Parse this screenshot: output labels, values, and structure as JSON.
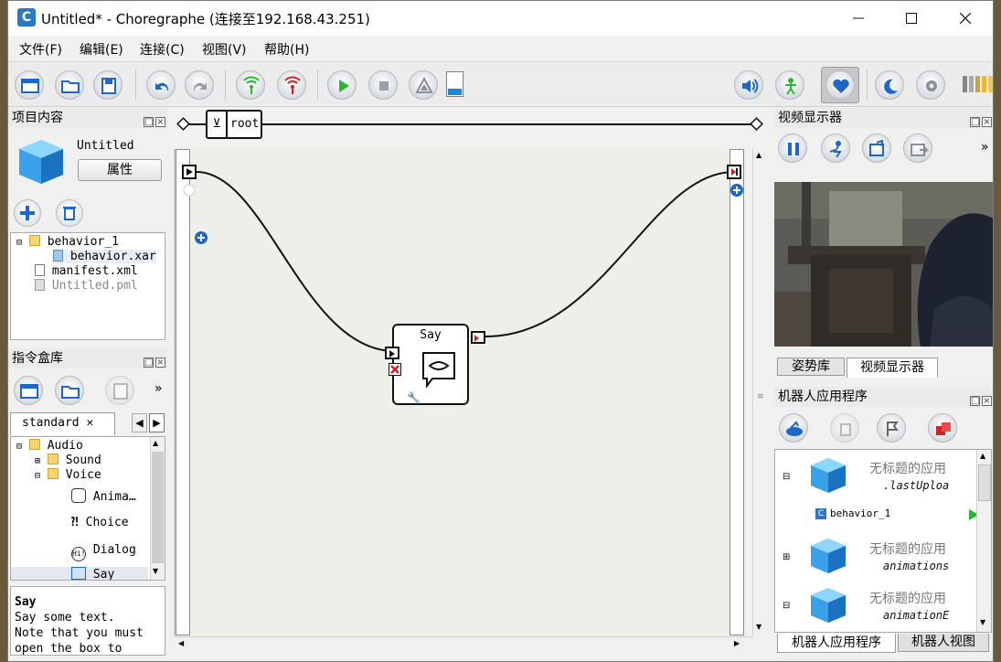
{
  "window": {
    "title": "Untitled* - Choregraphe (连接至192.168.43.251)",
    "app_icon": "C",
    "controls": [
      "minimize",
      "maximize",
      "close"
    ]
  },
  "menu": [
    "文件(F)",
    "编辑(E)",
    "连接(C)",
    "视图(V)",
    "帮助(H)"
  ],
  "toolbar": {
    "icons": [
      "new-window-icon",
      "open-folder-icon",
      "save-icon",
      "undo-icon",
      "redo-icon",
      "connect-icon",
      "disconnect-icon",
      "play-icon",
      "stop-icon",
      "debug-icon",
      "volume-icon",
      "robot-posture-icon",
      "heart-icon",
      "sleep-icon",
      "settings-icon",
      "battery-icon"
    ],
    "accent_green": "#2db52d",
    "accent_blue": "#1e66c8",
    "accent_red": "#d02020"
  },
  "project": {
    "header": "项目内容",
    "name": "Untitled",
    "properties_button": "属性",
    "tree": [
      {
        "label": "behavior_1",
        "type": "folder"
      },
      {
        "label": "behavior.xar",
        "type": "file"
      },
      {
        "label": "manifest.xml",
        "type": "file"
      },
      {
        "label": "Untitled.pml",
        "type": "file-grey"
      }
    ]
  },
  "library": {
    "header": "指令盒库",
    "tab": "standard",
    "tree": [
      {
        "label": "Audio"
      },
      {
        "label": "Sound"
      },
      {
        "label": "Voice"
      },
      {
        "label": "Anima…"
      },
      {
        "label": "Choice"
      },
      {
        "label": "Dialog"
      },
      {
        "label": "Say"
      }
    ],
    "description": {
      "title": "Say",
      "line1": "Say some text.",
      "line2": "Note that you must",
      "line3": "open the box to"
    }
  },
  "flow": {
    "breadcrumb": "root",
    "box_title": "Say"
  },
  "video_panel": {
    "header": "视频显示器",
    "tabs": [
      "姿势库",
      "视频显示器"
    ]
  },
  "robot_apps": {
    "header": "机器人应用程序",
    "items": [
      {
        "title": "无标题的应用",
        "sub": ".lastUploa"
      },
      {
        "child": "behavior_1"
      },
      {
        "title": "无标题的应用",
        "sub": "animations"
      },
      {
        "title": "无标题的应用",
        "sub": "animationE"
      }
    ],
    "tabs": [
      "机器人应用程序",
      "机器人视图"
    ]
  }
}
